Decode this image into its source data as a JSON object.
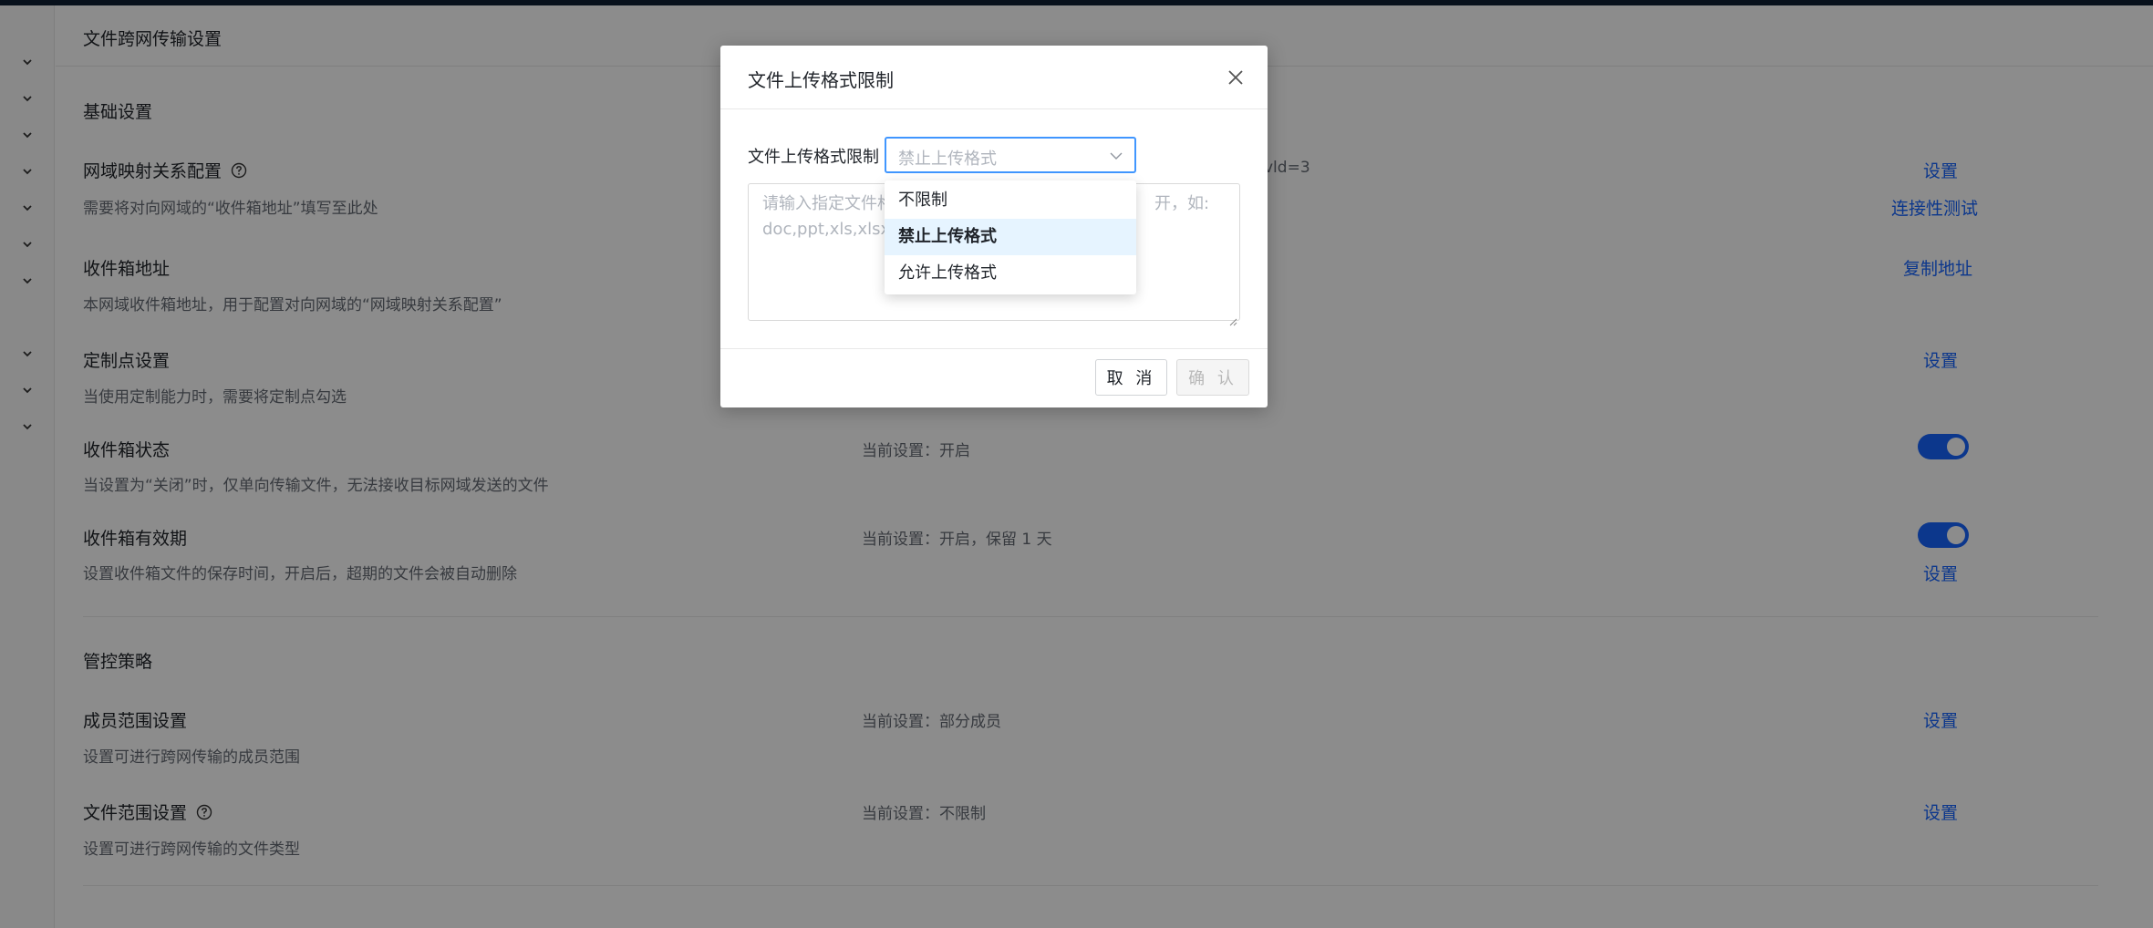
{
  "page": {
    "title": "文件跨网传输设置",
    "basic_section": "基础设置",
    "control_section": "管控策略",
    "partial_value": "vld=3"
  },
  "rows": {
    "network_mapping": {
      "title": "网域映射关系配置",
      "desc": "需要将对向网域的“收件箱地址”填写至此处",
      "link1": "设置",
      "link2": "连接性测试"
    },
    "inbox_address": {
      "title": "收件箱地址",
      "desc": "本网域收件箱地址，用于配置对向网域的“网域映射关系配置”",
      "link": "复制地址"
    },
    "custom_point": {
      "title": "定制点设置",
      "desc": "当使用定制能力时，需要将定制点勾选",
      "link": "设置"
    },
    "inbox_status": {
      "title": "收件箱状态",
      "desc": "当设置为“关闭”时，仅单向传输文件，无法接收目标网域发送的文件",
      "value": "当前设置：开启",
      "toggle_on": true
    },
    "inbox_validity": {
      "title": "收件箱有效期",
      "desc": "设置收件箱文件的保存时间，开启后，超期的文件会被自动删除",
      "value": "当前设置：开启，保留 1 天",
      "link": "设置",
      "toggle_on": true
    },
    "member_scope": {
      "title": "成员范围设置",
      "desc": "设置可进行跨网传输的成员范围",
      "value": "当前设置：部分成员",
      "link": "设置"
    },
    "file_scope": {
      "title": "文件范围设置",
      "desc": "设置可进行跨网传输的文件类型",
      "value": "当前设置：不限制",
      "link": "设置"
    }
  },
  "modal": {
    "title": "文件上传格式限制",
    "form_label": "文件上传格式限制",
    "select_placeholder": "禁止上传格式",
    "textarea_line1a": "请输入指定文件格",
    "textarea_line1b": "开，如:",
    "textarea_line2": "doc,ppt,xls,xlsx,p",
    "cancel_label": "取 消",
    "confirm_label": "确 认"
  },
  "dropdown": {
    "options": [
      "不限制",
      "禁止上传格式",
      "允许上传格式"
    ],
    "selected_index": 1
  },
  "colors": {
    "accent": "#1664ff",
    "select_border": "#4096ff",
    "selected_option_bg": "#e6f4ff",
    "mask": "rgba(0,0,0,0.45)"
  }
}
